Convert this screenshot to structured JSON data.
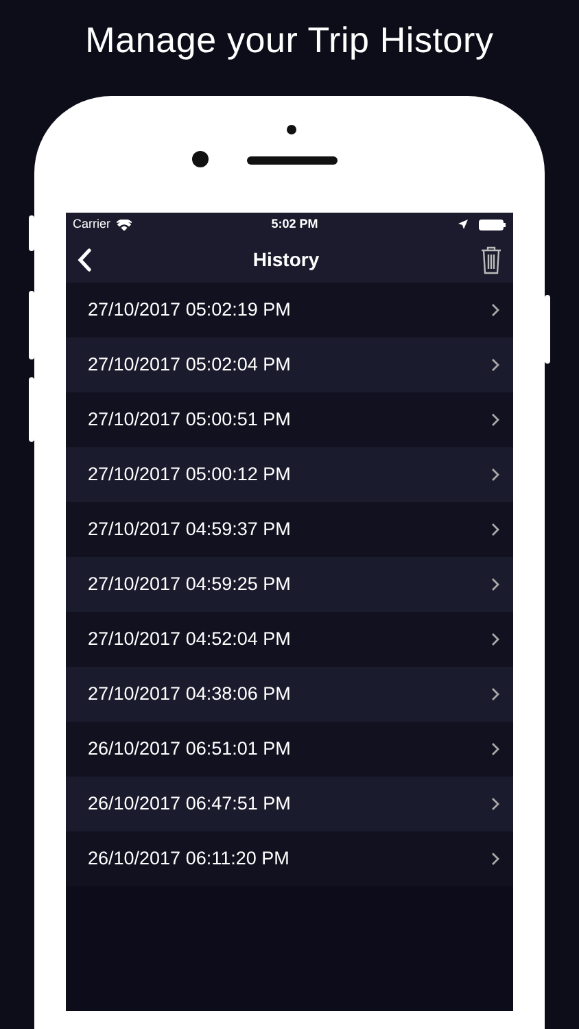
{
  "heading": "Manage your Trip History",
  "status_bar": {
    "carrier": "Carrier",
    "time": "5:02 PM"
  },
  "nav": {
    "title": "History"
  },
  "rows": [
    {
      "text": "27/10/2017 05:02:19 PM"
    },
    {
      "text": "27/10/2017 05:02:04 PM"
    },
    {
      "text": "27/10/2017 05:00:51 PM"
    },
    {
      "text": "27/10/2017 05:00:12 PM"
    },
    {
      "text": "27/10/2017 04:59:37 PM"
    },
    {
      "text": "27/10/2017 04:59:25 PM"
    },
    {
      "text": "27/10/2017 04:52:04 PM"
    },
    {
      "text": "27/10/2017 04:38:06 PM"
    },
    {
      "text": "26/10/2017 06:51:01 PM"
    },
    {
      "text": "26/10/2017 06:47:51 PM"
    },
    {
      "text": "26/10/2017 06:11:20 PM"
    }
  ]
}
